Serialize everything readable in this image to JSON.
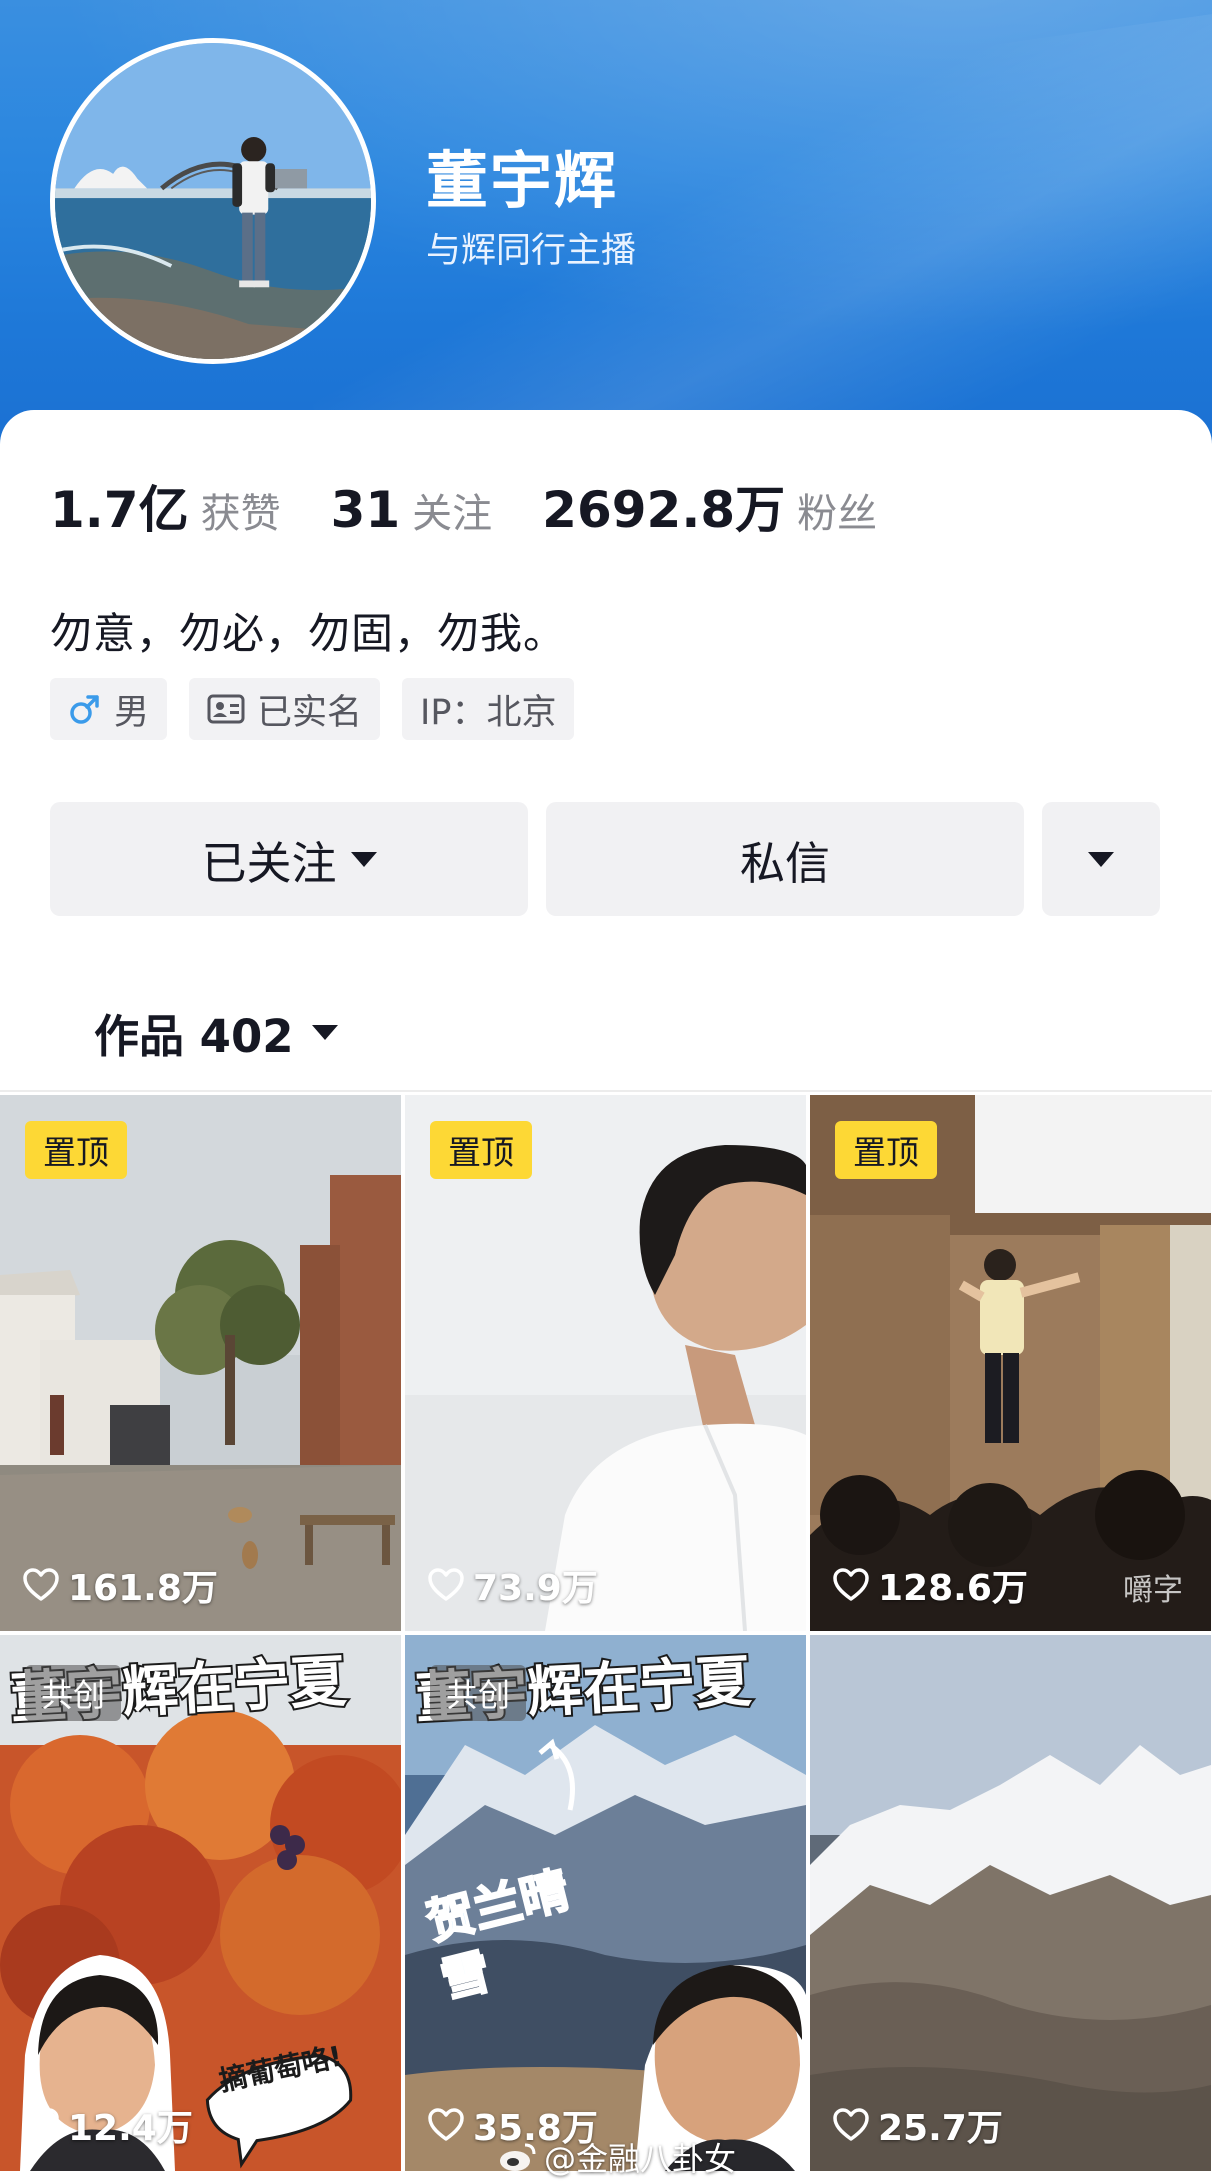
{
  "profile": {
    "name": "董宇辉",
    "subtitle": "与辉同行主播",
    "bio": "勿意，勿必，勿固，勿我。"
  },
  "stats": [
    {
      "value": "1.7亿",
      "label": "获赞"
    },
    {
      "value": "31",
      "label": "关注"
    },
    {
      "value": "2692.8万",
      "label": "粉丝"
    }
  ],
  "tags": [
    {
      "icon": "male-icon",
      "label": "男"
    },
    {
      "icon": "id-card-icon",
      "label": "已实名"
    },
    {
      "icon": "",
      "label": "IP：北京"
    }
  ],
  "actions": {
    "follow_label": "已关注",
    "message_label": "私信"
  },
  "works": {
    "label": "作品 402"
  },
  "videos": [
    {
      "badge": "置顶",
      "likes": "161.8万"
    },
    {
      "badge": "置顶",
      "likes": "73.9万"
    },
    {
      "badge": "置顶",
      "likes": "128.6万",
      "tile_watermark": "嚼字"
    },
    {
      "badge": "共创",
      "likes": "12.4万",
      "overlay_title": "董宇辉在宁夏",
      "sticker": "摘葡萄咯!"
    },
    {
      "badge": "共创",
      "likes": "35.8万",
      "overlay_title": "董宇辉在宁夏",
      "caption": "贺兰晴雪"
    },
    {
      "badge": "",
      "likes": "25.7万"
    }
  ],
  "watermark": "@金融八卦女",
  "colors": {
    "banner": "#2a86df",
    "pin_badge": "#fdd835",
    "button_bg": "#f1f1f3",
    "male_icon": "#3b9bea"
  }
}
